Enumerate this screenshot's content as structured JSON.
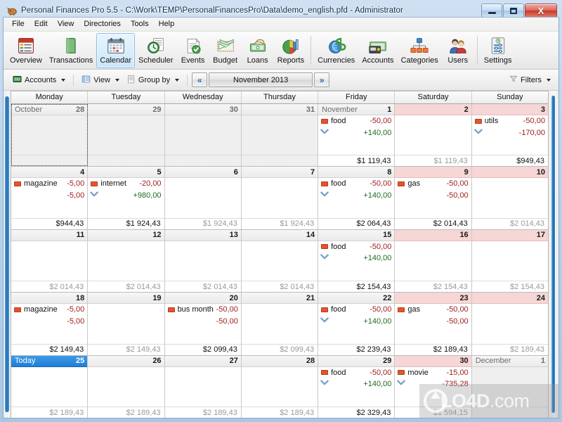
{
  "window": {
    "title": "Personal Finances Pro 5.5 - C:\\Work\\TEMP\\PersonalFinancesPro\\Data\\demo_english.pfd - Administrator",
    "minimize_label": "",
    "maximize_label": "",
    "close_label": "X",
    "app_icon": "piggy-bank-icon"
  },
  "menu": {
    "items": [
      "File",
      "Edit",
      "View",
      "Directories",
      "Tools",
      "Help"
    ]
  },
  "toolbar": {
    "buttons": [
      {
        "label": "Overview",
        "icon": "overview-icon",
        "active": false
      },
      {
        "label": "Transactions",
        "icon": "transactions-icon",
        "active": false
      },
      {
        "label": "Calendar",
        "icon": "calendar-icon",
        "active": true
      },
      {
        "label": "Scheduler",
        "icon": "scheduler-icon",
        "active": false
      },
      {
        "label": "Events",
        "icon": "events-icon",
        "active": false
      },
      {
        "label": "Budget",
        "icon": "budget-icon",
        "active": false
      },
      {
        "label": "Loans",
        "icon": "loans-icon",
        "active": false
      },
      {
        "label": "Reports",
        "icon": "reports-icon",
        "active": false
      },
      {
        "label": "Currencies",
        "icon": "currencies-icon",
        "active": false
      },
      {
        "label": "Accounts",
        "icon": "accounts-icon",
        "active": false
      },
      {
        "label": "Categories",
        "icon": "categories-icon",
        "active": false
      },
      {
        "label": "Users",
        "icon": "users-icon",
        "active": false
      },
      {
        "label": "Settings",
        "icon": "settings-icon",
        "active": false
      }
    ],
    "separator_after": [
      7,
      11
    ]
  },
  "toolbar2": {
    "accounts_label": "Accounts",
    "view_label": "View",
    "groupby_label": "Group by",
    "prev_label": "«",
    "period_label": "November 2013",
    "next_label": "»",
    "filters_label": "Filters"
  },
  "calendar": {
    "day_headers": [
      "Monday",
      "Tuesday",
      "Wednesday",
      "Thursday",
      "Friday",
      "Saturday",
      "Sunday"
    ],
    "weeks": [
      [
        {
          "month": "October",
          "num": "28",
          "other": true,
          "weekend": false,
          "selected": true,
          "txns": [],
          "sub": null,
          "balance": "",
          "balance_muted": true
        },
        {
          "month": "",
          "num": "29",
          "other": true,
          "weekend": false,
          "txns": [],
          "sub": null,
          "balance": "",
          "balance_muted": true
        },
        {
          "month": "",
          "num": "30",
          "other": true,
          "weekend": false,
          "txns": [],
          "sub": null,
          "balance": "",
          "balance_muted": true
        },
        {
          "month": "",
          "num": "31",
          "other": true,
          "weekend": false,
          "txns": [],
          "sub": null,
          "balance": "",
          "balance_muted": true
        },
        {
          "month": "November",
          "num": "1",
          "other": false,
          "weekend": false,
          "txns": [
            {
              "name": "food",
              "amount": "-50,00"
            }
          ],
          "sub": {
            "chevron": true,
            "value": "+140,00",
            "sign": "pos"
          },
          "balance": "$1 119,43",
          "balance_muted": false
        },
        {
          "month": "",
          "num": "2",
          "other": false,
          "weekend": true,
          "txns": [],
          "sub": null,
          "balance": "$1 119,43",
          "balance_muted": true
        },
        {
          "month": "",
          "num": "3",
          "other": false,
          "weekend": true,
          "txns": [
            {
              "name": "utils",
              "amount": "-50,00"
            }
          ],
          "sub": {
            "chevron": true,
            "value": "-170,00",
            "sign": "neg"
          },
          "balance": "$949,43",
          "balance_muted": false
        }
      ],
      [
        {
          "month": "",
          "num": "4",
          "other": false,
          "weekend": false,
          "txns": [
            {
              "name": "magazine",
              "amount": "-5,00"
            }
          ],
          "sub": {
            "chevron": false,
            "value": "-5,00",
            "sign": "neg"
          },
          "balance": "$944,43",
          "balance_muted": false
        },
        {
          "month": "",
          "num": "5",
          "other": false,
          "weekend": false,
          "txns": [
            {
              "name": "internet",
              "amount": "-20,00"
            }
          ],
          "sub": {
            "chevron": true,
            "value": "+980,00",
            "sign": "pos"
          },
          "balance": "$1 924,43",
          "balance_muted": false
        },
        {
          "month": "",
          "num": "6",
          "other": false,
          "weekend": false,
          "txns": [],
          "sub": null,
          "balance": "$1 924,43",
          "balance_muted": true
        },
        {
          "month": "",
          "num": "7",
          "other": false,
          "weekend": false,
          "txns": [],
          "sub": null,
          "balance": "$1 924,43",
          "balance_muted": true
        },
        {
          "month": "",
          "num": "8",
          "other": false,
          "weekend": false,
          "txns": [
            {
              "name": "food",
              "amount": "-50,00"
            }
          ],
          "sub": {
            "chevron": true,
            "value": "+140,00",
            "sign": "pos"
          },
          "balance": "$2 064,43",
          "balance_muted": false
        },
        {
          "month": "",
          "num": "9",
          "other": false,
          "weekend": true,
          "txns": [
            {
              "name": "gas",
              "amount": "-50,00"
            }
          ],
          "sub": {
            "chevron": false,
            "value": "-50,00",
            "sign": "neg"
          },
          "balance": "$2 014,43",
          "balance_muted": false
        },
        {
          "month": "",
          "num": "10",
          "other": false,
          "weekend": true,
          "txns": [],
          "sub": null,
          "balance": "$2 014,43",
          "balance_muted": true
        }
      ],
      [
        {
          "month": "",
          "num": "11",
          "other": false,
          "weekend": false,
          "txns": [],
          "sub": null,
          "balance": "$2 014,43",
          "balance_muted": true
        },
        {
          "month": "",
          "num": "12",
          "other": false,
          "weekend": false,
          "txns": [],
          "sub": null,
          "balance": "$2 014,43",
          "balance_muted": true
        },
        {
          "month": "",
          "num": "13",
          "other": false,
          "weekend": false,
          "txns": [],
          "sub": null,
          "balance": "$2 014,43",
          "balance_muted": true
        },
        {
          "month": "",
          "num": "14",
          "other": false,
          "weekend": false,
          "txns": [],
          "sub": null,
          "balance": "$2 014,43",
          "balance_muted": true
        },
        {
          "month": "",
          "num": "15",
          "other": false,
          "weekend": false,
          "txns": [
            {
              "name": "food",
              "amount": "-50,00"
            }
          ],
          "sub": {
            "chevron": true,
            "value": "+140,00",
            "sign": "pos"
          },
          "balance": "$2 154,43",
          "balance_muted": false
        },
        {
          "month": "",
          "num": "16",
          "other": false,
          "weekend": true,
          "txns": [],
          "sub": null,
          "balance": "$2 154,43",
          "balance_muted": true
        },
        {
          "month": "",
          "num": "17",
          "other": false,
          "weekend": true,
          "txns": [],
          "sub": null,
          "balance": "$2 154,43",
          "balance_muted": true
        }
      ],
      [
        {
          "month": "",
          "num": "18",
          "other": false,
          "weekend": false,
          "txns": [
            {
              "name": "magazine",
              "amount": "-5,00"
            }
          ],
          "sub": {
            "chevron": false,
            "value": "-5,00",
            "sign": "neg"
          },
          "balance": "$2 149,43",
          "balance_muted": false
        },
        {
          "month": "",
          "num": "19",
          "other": false,
          "weekend": false,
          "txns": [],
          "sub": null,
          "balance": "$2 149,43",
          "balance_muted": true
        },
        {
          "month": "",
          "num": "20",
          "other": false,
          "weekend": false,
          "txns": [
            {
              "name": "bus monthl",
              "amount": "-50,00"
            }
          ],
          "sub": {
            "chevron": false,
            "value": "-50,00",
            "sign": "neg"
          },
          "balance": "$2 099,43",
          "balance_muted": false
        },
        {
          "month": "",
          "num": "21",
          "other": false,
          "weekend": false,
          "txns": [],
          "sub": null,
          "balance": "$2 099,43",
          "balance_muted": true
        },
        {
          "month": "",
          "num": "22",
          "other": false,
          "weekend": false,
          "txns": [
            {
              "name": "food",
              "amount": "-50,00"
            }
          ],
          "sub": {
            "chevron": true,
            "value": "+140,00",
            "sign": "pos"
          },
          "balance": "$2 239,43",
          "balance_muted": false
        },
        {
          "month": "",
          "num": "23",
          "other": false,
          "weekend": true,
          "txns": [
            {
              "name": "gas",
              "amount": "-50,00"
            }
          ],
          "sub": {
            "chevron": false,
            "value": "-50,00",
            "sign": "neg"
          },
          "balance": "$2 189,43",
          "balance_muted": false
        },
        {
          "month": "",
          "num": "24",
          "other": false,
          "weekend": true,
          "txns": [],
          "sub": null,
          "balance": "$2 189,43",
          "balance_muted": true
        }
      ],
      [
        {
          "month": "Today",
          "num": "25",
          "other": false,
          "weekend": false,
          "today": true,
          "txns": [],
          "sub": null,
          "balance": "$2 189,43",
          "balance_muted": true
        },
        {
          "month": "",
          "num": "26",
          "other": false,
          "weekend": false,
          "txns": [],
          "sub": null,
          "balance": "$2 189,43",
          "balance_muted": true
        },
        {
          "month": "",
          "num": "27",
          "other": false,
          "weekend": false,
          "txns": [],
          "sub": null,
          "balance": "$2 189,43",
          "balance_muted": true
        },
        {
          "month": "",
          "num": "28",
          "other": false,
          "weekend": false,
          "txns": [],
          "sub": null,
          "balance": "$2 189,43",
          "balance_muted": true
        },
        {
          "month": "",
          "num": "29",
          "other": false,
          "weekend": false,
          "txns": [
            {
              "name": "food",
              "amount": "-50,00"
            }
          ],
          "sub": {
            "chevron": true,
            "value": "+140,00",
            "sign": "pos"
          },
          "balance": "$2 329,43",
          "balance_muted": false
        },
        {
          "month": "",
          "num": "30",
          "other": false,
          "weekend": true,
          "txns": [
            {
              "name": "movie",
              "amount": "-15,00"
            }
          ],
          "sub": {
            "chevron": true,
            "value": "-735,28",
            "sign": "neg"
          },
          "balance": "$1 594,15",
          "balance_muted": true
        },
        {
          "month": "December",
          "num": "1",
          "other": true,
          "weekend": false,
          "txns": [],
          "sub": null,
          "balance": "",
          "balance_muted": true
        }
      ]
    ]
  },
  "watermark": {
    "text_left": "LO4D",
    "text_right": ".com"
  },
  "colors": {
    "accent": "#1e7ed6",
    "weekend": "#f7d6d6",
    "negative": "#a02020",
    "positive": "#1e6b1e",
    "category_marker": "#e8522f"
  }
}
